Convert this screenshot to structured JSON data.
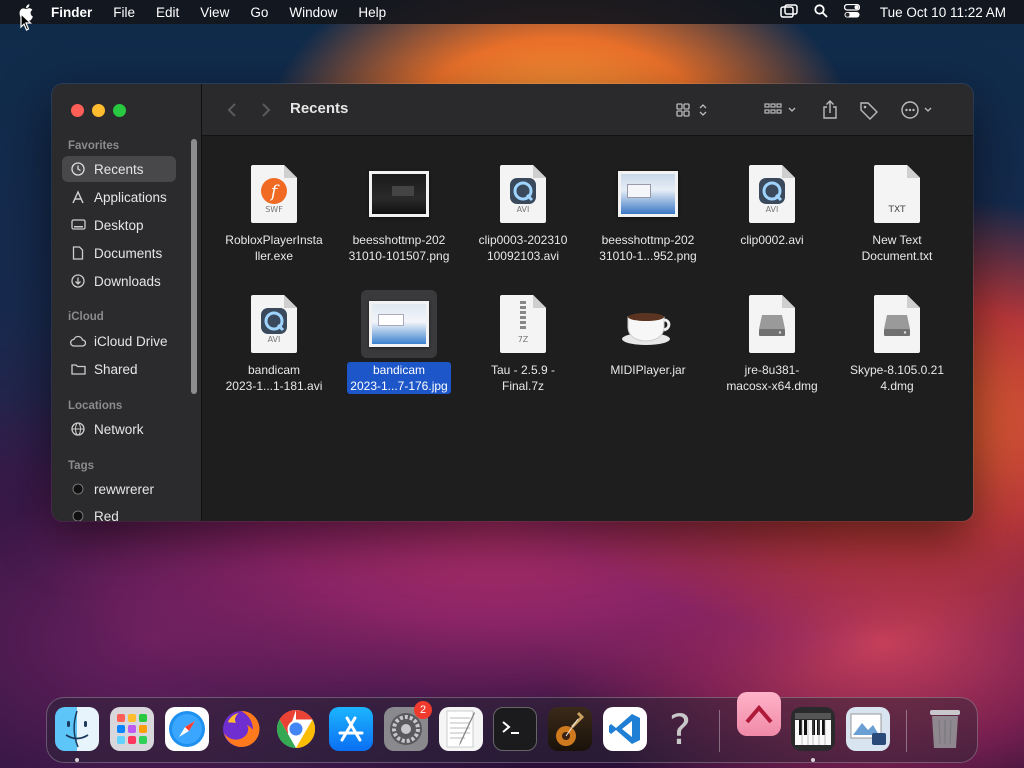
{
  "menubar": {
    "app_name": "Finder",
    "menus": [
      "File",
      "Edit",
      "View",
      "Go",
      "Window",
      "Help"
    ],
    "clock": "Tue Oct 10  11:22 AM",
    "icons": [
      "apple-icon",
      "window-stack-icon",
      "spotlight-search-icon",
      "control-center-icon"
    ]
  },
  "window": {
    "title": "Recents",
    "traffic_lights": [
      "close",
      "minimize",
      "zoom"
    ]
  },
  "sidebar": {
    "sections": {
      "favorites": "Favorites",
      "icloud": "iCloud",
      "locations": "Locations",
      "tags": "Tags"
    },
    "favorites": [
      {
        "label": "Recents",
        "icon": "clock-icon",
        "active": true
      },
      {
        "label": "Applications",
        "icon": "applications-icon"
      },
      {
        "label": "Desktop",
        "icon": "desktop-icon"
      },
      {
        "label": "Documents",
        "icon": "document-icon"
      },
      {
        "label": "Downloads",
        "icon": "download-icon"
      }
    ],
    "icloud": [
      {
        "label": "iCloud Drive",
        "icon": "cloud-icon"
      },
      {
        "label": "Shared",
        "icon": "shared-folder-icon"
      }
    ],
    "locations": [
      {
        "label": "Network",
        "icon": "globe-icon"
      }
    ],
    "tags": [
      {
        "label": "rewwrerer",
        "color": "#111111"
      },
      {
        "label": "Red",
        "color": "#111111"
      }
    ]
  },
  "files": [
    {
      "name": "RobloxPlayerInsta ller.exe",
      "line1": "RobloxPlayerInsta",
      "line2": "ller.exe",
      "kind": "swf",
      "tag": "SWF"
    },
    {
      "name": "beesshottmp-2023 1010-101507.png",
      "line1": "beesshottmp-202",
      "line2": "31010-101507.png",
      "kind": "screenshot-dark"
    },
    {
      "name": "clip0003-202310 10092103.avi",
      "line1": "clip0003-202310",
      "line2": "10092103.avi",
      "kind": "avi",
      "tag": "AVI"
    },
    {
      "name": "beesshottmp-202 31010-1...952.png",
      "line1": "beesshottmp-202",
      "line2": "31010-1...952.png",
      "kind": "screenshot-light"
    },
    {
      "name": "clip0002.avi",
      "line1": "clip0002.avi",
      "line2": "",
      "kind": "avi",
      "tag": "AVI"
    },
    {
      "name": "New Text Document.txt",
      "line1": "New Text",
      "line2": "Document.txt",
      "kind": "txt",
      "tag": "TXT"
    },
    {
      "name": "bandicam 2023-1...1-181.avi",
      "line1": "bandicam",
      "line2": "2023-1...1-181.avi",
      "kind": "avi",
      "tag": "AVI"
    },
    {
      "name": "bandicam 2023-1...7-176.jpg",
      "line1": "bandicam",
      "line2": "2023-1...7-176.jpg",
      "kind": "screenshot-light",
      "selected": true
    },
    {
      "name": "Tau - 2.5.9 - Final.7z",
      "line1": "Tau - 2.5.9 -",
      "line2": "Final.7z",
      "kind": "zip",
      "tag": "7Z"
    },
    {
      "name": "MIDIPlayer.jar",
      "line1": "MIDIPlayer.jar",
      "line2": "",
      "kind": "jar"
    },
    {
      "name": "jre-8u381-macosx-x64.dmg",
      "line1": "jre-8u381-",
      "line2": "macosx-x64.dmg",
      "kind": "dmg"
    },
    {
      "name": "Skype-8.105.0.214.dmg",
      "line1": "Skype-8.105.0.21",
      "line2": "4.dmg",
      "kind": "dmg"
    }
  ],
  "toolbar": {
    "icons": [
      "back-icon",
      "forward-icon",
      "icon-view-icon",
      "group-icon",
      "share-icon",
      "tag-icon",
      "more-actions-icon",
      "search-icon"
    ]
  },
  "dock": {
    "apps": [
      {
        "name": "Finder",
        "icon": "finder-icon",
        "running": true
      },
      {
        "name": "Launchpad",
        "icon": "launchpad-icon"
      },
      {
        "name": "Safari",
        "icon": "safari-icon"
      },
      {
        "name": "Firefox",
        "icon": "firefox-icon"
      },
      {
        "name": "Chrome",
        "icon": "chrome-icon"
      },
      {
        "name": "App Store",
        "icon": "app-store-icon"
      },
      {
        "name": "System Settings",
        "icon": "system-settings-icon",
        "badge": "2"
      },
      {
        "name": "TextEdit",
        "icon": "textedit-icon"
      },
      {
        "name": "Terminal",
        "icon": "terminal-icon"
      },
      {
        "name": "GarageBand",
        "icon": "garageband-icon"
      },
      {
        "name": "Visual Studio Code",
        "icon": "vscode-icon"
      },
      {
        "name": "Unknown App",
        "icon": "question-mark-icon"
      },
      {
        "name": "Pink App",
        "icon": "pink-app-icon"
      },
      {
        "name": "MIDI Keyboard",
        "icon": "piano-icon",
        "running": true
      },
      {
        "name": "Preview",
        "icon": "preview-icon"
      },
      {
        "name": "Trash",
        "icon": "trash-icon"
      }
    ]
  },
  "colors": {
    "selection": "#1d56c9",
    "sidebar_active": "#48484b",
    "window_bg": "#1e1e1e"
  }
}
